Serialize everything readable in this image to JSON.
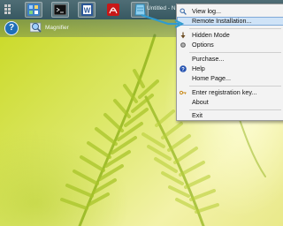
{
  "taskbar": {
    "window_title": "Untitled - N",
    "icons": [
      "app-grid-icon",
      "control-panel-icon",
      "command-prompt-icon",
      "word-icon",
      "pdf-reader-icon",
      "notepad-icon"
    ]
  },
  "toolbar2": {
    "help_label": "?",
    "magnifier_label": "Magnifier"
  },
  "context_menu": {
    "view_log": "View log...",
    "remote_installation": "Remote Installation...",
    "hidden_mode": "Hidden Mode",
    "options": "Options",
    "purchase": "Purchase...",
    "help": "Help",
    "home_page": "Home Page...",
    "enter_registration_key": "Enter registration key...",
    "about": "About",
    "exit": "Exit",
    "highlighted_item": "Remote Installation..."
  },
  "colors": {
    "taskbar": "#3f6068",
    "menu_background": "#f3f3f3",
    "menu_highlight": "#cfe3f7",
    "annotation": "#3aa0c8"
  }
}
